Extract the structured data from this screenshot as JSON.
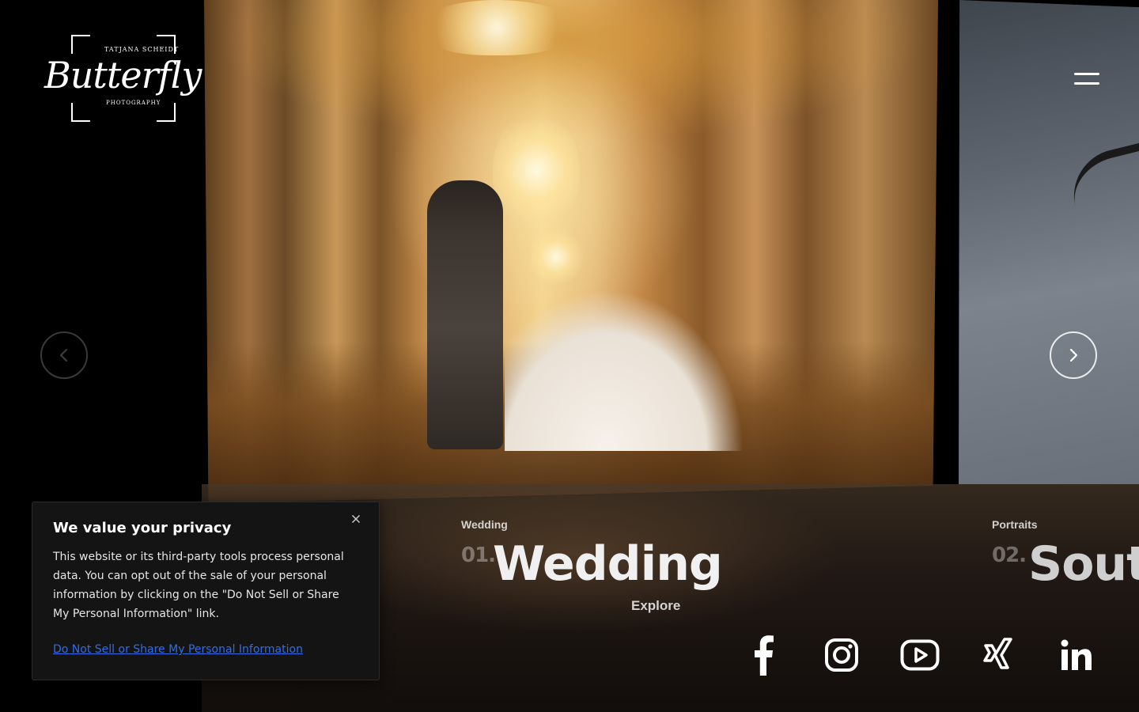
{
  "logo": {
    "word": "Butterfly",
    "top_text": "TATJANA SCHEIDT",
    "bottom_text": "PHOTOGRAPHY"
  },
  "slides": [
    {
      "category": "Wedding",
      "number": "01.",
      "title": "Wedding",
      "cta": "Explore"
    },
    {
      "category": "Portraits",
      "number": "02.",
      "title": "South"
    }
  ],
  "privacy": {
    "title": "We value your privacy",
    "body": "This website or its third-party tools process personal data. You can opt out of the sale of your personal information by clicking on the \"Do Not Sell or Share My Personal Information\" link.",
    "link": "Do Not Sell or Share My Personal Information"
  },
  "icons": {
    "menu": "menu-icon",
    "prev": "chevron-left-icon",
    "next": "chevron-right-icon",
    "close": "close-icon",
    "social": [
      "facebook-icon",
      "instagram-icon",
      "youtube-icon",
      "xing-icon",
      "linkedin-icon"
    ]
  },
  "colors": {
    "background": "#000000",
    "link": "#2f6de8",
    "panel": "#141414"
  }
}
